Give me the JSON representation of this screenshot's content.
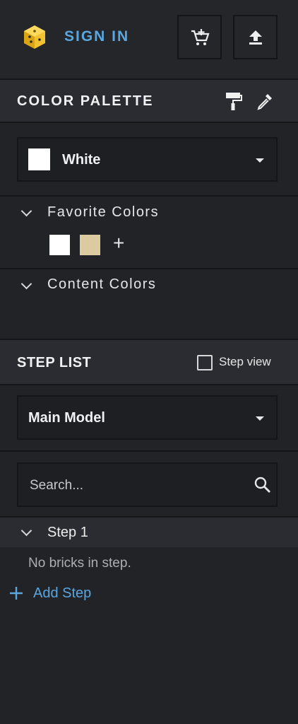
{
  "header": {
    "sign_in_label": "SIGN IN",
    "logo_icon": "cube-logo-icon",
    "cart_icon": "add-to-cart-icon",
    "upload_icon": "upload-icon"
  },
  "color_palette": {
    "title": "COLOR PALETTE",
    "tools": [
      "paint-roller-icon",
      "eyedropper-icon"
    ],
    "selected_color": {
      "name": "White",
      "hex": "#ffffff"
    },
    "favorite_colors": {
      "title": "Favorite Colors",
      "swatches": [
        {
          "hex": "#ffffff"
        },
        {
          "hex": "#dccaa0"
        }
      ],
      "add_label": "+"
    },
    "content_colors": {
      "title": "Content Colors"
    }
  },
  "step_list": {
    "title": "STEP LIST",
    "step_view_label": "Step view",
    "step_view_checked": false,
    "model_select": "Main Model",
    "search_placeholder": "Search...",
    "steps": [
      {
        "label": "Step 1",
        "empty_text": "No bricks in step."
      }
    ],
    "add_step_label": "Add Step"
  },
  "colors": {
    "accent": "#5aa6df",
    "background": "#222327",
    "header_bg": "#2b2c31",
    "divider": "#141518"
  }
}
